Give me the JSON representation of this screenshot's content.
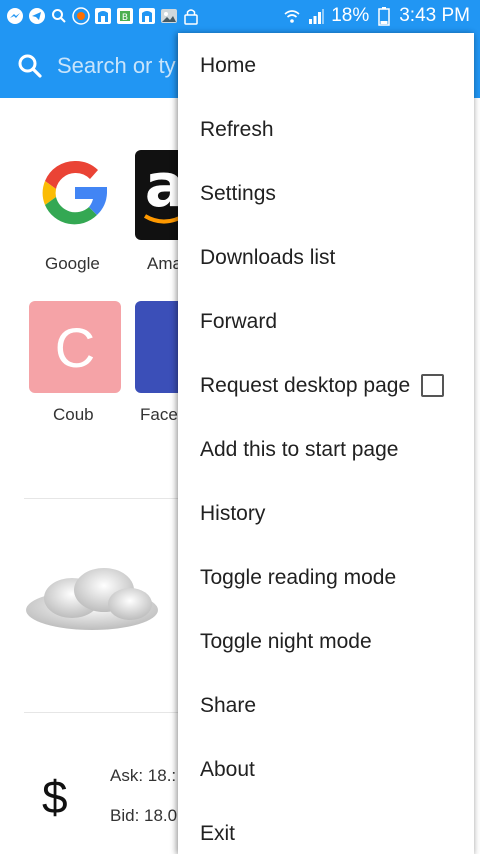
{
  "status_bar": {
    "icons": [
      "messenger-icon",
      "telegram-icon",
      "search-icon",
      "shield-icon",
      "app-icon-1",
      "gallery-icon",
      "app-icon-2",
      "photo-icon",
      "lock-icon"
    ],
    "battery": "18%",
    "time": "3:43 PM"
  },
  "search": {
    "placeholder": "Search or ty"
  },
  "speed_dial": [
    {
      "label": "Google",
      "icon": "google-icon"
    },
    {
      "label": "Ama",
      "icon": "amazon-icon"
    },
    {
      "label": "Coub",
      "icon": "coub-icon",
      "letter": "C"
    },
    {
      "label": "Face",
      "icon": "facebook-icon"
    }
  ],
  "quote": {
    "symbol": "$",
    "ask": "Ask: 18.:",
    "bid": "Bid: 18.0"
  },
  "menu": {
    "items": [
      {
        "label": "Home"
      },
      {
        "label": "Refresh"
      },
      {
        "label": "Settings"
      },
      {
        "label": "Downloads list"
      },
      {
        "label": "Forward"
      },
      {
        "label": "Request desktop page"
      },
      {
        "label": "Add this to start page"
      },
      {
        "label": "History"
      },
      {
        "label": "Toggle reading mode"
      },
      {
        "label": "Toggle night mode"
      },
      {
        "label": "Share"
      },
      {
        "label": "About"
      },
      {
        "label": "Exit"
      }
    ],
    "request_desktop_checked": false
  },
  "colors": {
    "accent": "#2196f3",
    "coub_tile": "#f5a3a7",
    "facebook_tile": "#3b4fb8"
  }
}
